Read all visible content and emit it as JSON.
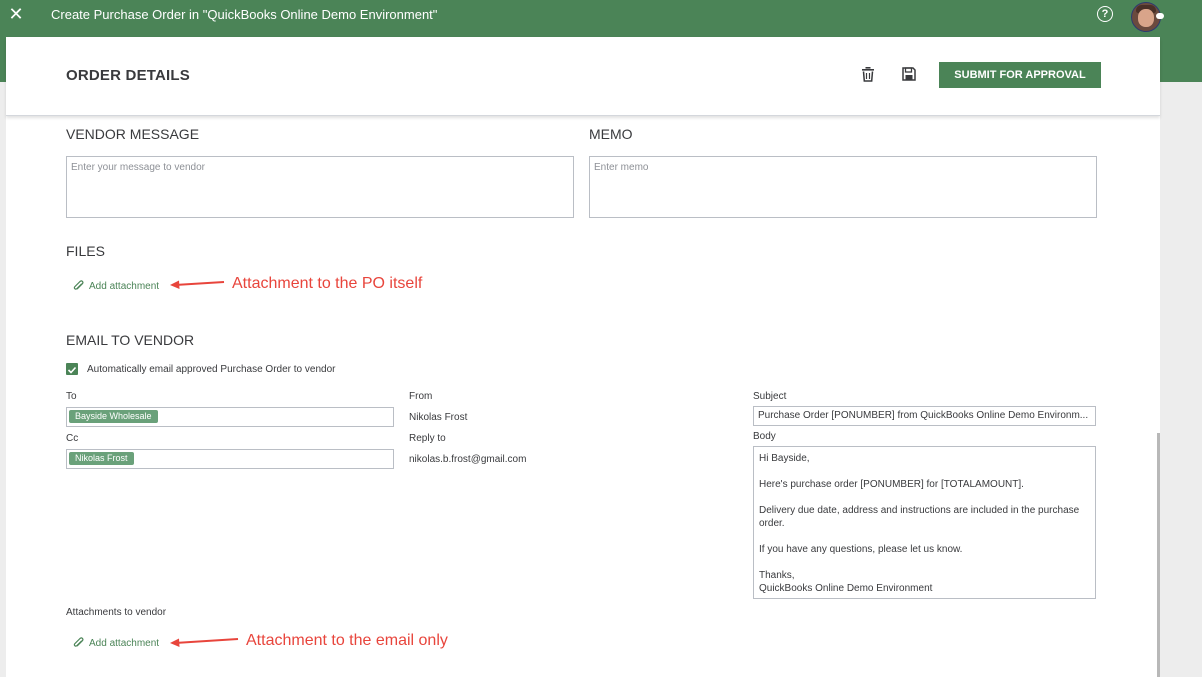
{
  "topbar": {
    "title": "Create Purchase Order in \"QuickBooks Online Demo Environment\"",
    "close_icon": "close-icon",
    "help_icon": "help-icon",
    "help_glyph": "?"
  },
  "header": {
    "title": "ORDER DETAILS",
    "submit_label": "SUBMIT FOR APPROVAL",
    "delete_icon": "trash-icon",
    "save_icon": "save-icon"
  },
  "vendor_message": {
    "title": "VENDOR MESSAGE",
    "placeholder": "Enter your message to vendor",
    "value": ""
  },
  "memo": {
    "title": "MEMO",
    "placeholder": "Enter memo",
    "value": ""
  },
  "files": {
    "title": "FILES",
    "add_attachment_label": "Add attachment",
    "annotation": "Attachment to the PO itself"
  },
  "email": {
    "title": "EMAIL TO VENDOR",
    "auto_email_label": "Automatically email approved Purchase Order to vendor",
    "auto_email_checked": true,
    "to_label": "To",
    "to_chip": "Bayside Wholesale",
    "cc_label": "Cc",
    "cc_chip": "Nikolas Frost",
    "from_label": "From",
    "from_value": "Nikolas Frost",
    "reply_to_label": "Reply to",
    "reply_to_value": "nikolas.b.frost@gmail.com",
    "subject_label": "Subject",
    "subject_value": "Purchase Order [PONUMBER] from QuickBooks Online Demo Environm...",
    "body_label": "Body",
    "body": {
      "line1": "Hi Bayside,",
      "line2": "Here's purchase order [PONUMBER] for [TOTALAMOUNT].",
      "line3": "Delivery due date, address and instructions are included in the purchase order.",
      "line4": "If you have any questions, please let us know.",
      "line5": "Thanks,",
      "line6": "QuickBooks Online Demo Environment"
    },
    "attachments_label": "Attachments to vendor",
    "add_attachment_label": "Add attachment",
    "annotation": "Attachment to the email only"
  },
  "colors": {
    "brand": "#4b8457",
    "chip": "#6aa17a",
    "annotation": "#e8453c"
  }
}
